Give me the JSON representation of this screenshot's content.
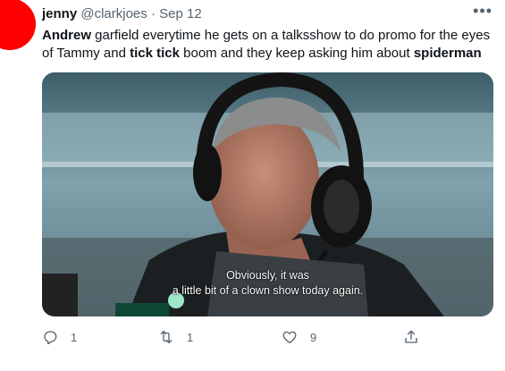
{
  "tweet": {
    "display_name": "jenny",
    "handle": "@clarkjoes",
    "separator": "·",
    "date": "Sep 12",
    "more_label": "•••",
    "text_parts": [
      {
        "text": "Andrew",
        "bold": true
      },
      {
        "text": " garfield everytime he gets on a talksshow to do promo for the eyes of Tammy and ",
        "bold": false
      },
      {
        "text": "tick tick",
        "bold": true
      },
      {
        "text": " boom and they keep asking him about ",
        "bold": false
      },
      {
        "text": "spiderman",
        "bold": true
      }
    ]
  },
  "media": {
    "subtitle_line1": "Obviously, it was",
    "subtitle_line2": "a little bit of a clown show today again."
  },
  "actions": {
    "reply_count": "1",
    "retweet_count": "1",
    "like_count": "9",
    "reply_icon": "reply-icon",
    "retweet_icon": "retweet-icon",
    "like_icon": "heart-icon",
    "share_icon": "share-icon"
  },
  "colors": {
    "avatar": "#ff0000",
    "text": "#0f1419",
    "muted": "#536471"
  }
}
